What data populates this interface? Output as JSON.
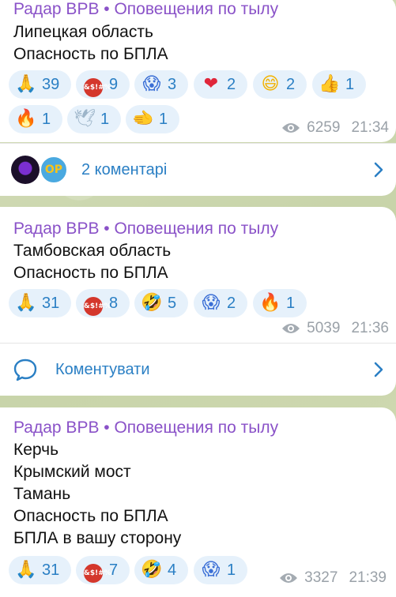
{
  "messages": [
    {
      "sender": "Радар ВРВ • Оповещения по тылу",
      "lines": [
        "Липецкая область",
        "Опасность по БПЛА"
      ],
      "reactions": [
        {
          "icon": "pray",
          "glyph": "🙏",
          "count": "39"
        },
        {
          "icon": "cursing-face",
          "glyph": "",
          "count": "9"
        },
        {
          "icon": "scream",
          "glyph": "😱",
          "count": "3"
        },
        {
          "icon": "heart",
          "glyph": "❤",
          "count": "2"
        },
        {
          "icon": "grin",
          "glyph": "😄",
          "count": "2"
        },
        {
          "icon": "thumbs-up",
          "glyph": "👍",
          "count": "1"
        },
        {
          "icon": "fire",
          "glyph": "🔥",
          "count": "1"
        },
        {
          "icon": "dove",
          "glyph": "🕊",
          "count": "1"
        },
        {
          "icon": "pointing-hand",
          "glyph": "🫲",
          "count": "1"
        }
      ],
      "views": "6259",
      "time": "21:34",
      "comments_label": "2 коментарі"
    },
    {
      "sender": "Радар ВРВ • Оповещения по тылу",
      "lines": [
        "Тамбовская область",
        "Опасность по БПЛА"
      ],
      "reactions": [
        {
          "icon": "pray",
          "glyph": "🙏",
          "count": "31"
        },
        {
          "icon": "cursing-face",
          "glyph": "",
          "count": "8"
        },
        {
          "icon": "rofl",
          "glyph": "🤣",
          "count": "5"
        },
        {
          "icon": "scream",
          "glyph": "😱",
          "count": "2"
        },
        {
          "icon": "fire",
          "glyph": "🔥",
          "count": "1"
        }
      ],
      "views": "5039",
      "time": "21:36",
      "comments_label": "Коментувати"
    },
    {
      "sender": "Радар ВРВ • Оповещения по тылу",
      "lines": [
        "Керчь",
        "Крымский мост",
        "Тамань",
        "Опасность по БПЛА",
        "БПЛА в вашу сторону"
      ],
      "reactions": [
        {
          "icon": "pray",
          "glyph": "🙏",
          "count": "31"
        },
        {
          "icon": "cursing-face",
          "glyph": "",
          "count": "7"
        },
        {
          "icon": "rofl",
          "glyph": "🤣",
          "count": "4"
        },
        {
          "icon": "scream",
          "glyph": "😱",
          "count": "1"
        }
      ],
      "views": "3327",
      "time": "21:39"
    }
  ],
  "curse_text": "&$!#%",
  "avatars": [
    {
      "icon": "channel-avatar-purple"
    },
    {
      "icon": "channel-avatar-op",
      "text": "OP"
    }
  ]
}
